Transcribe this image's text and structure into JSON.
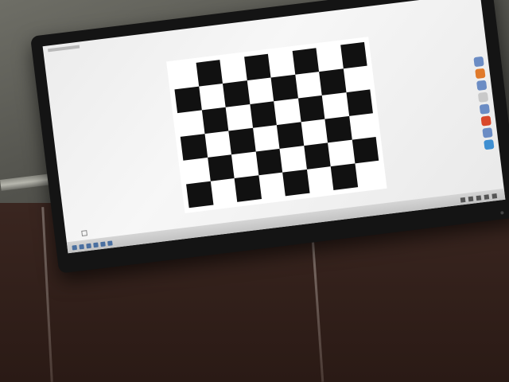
{
  "photo": {
    "subject": "",
    "monitor_content": "",
    "board": {
      "columns": 8,
      "rows": 6,
      "dark_color": "#111111",
      "light_color": "#ffffff",
      "first_cell_dark": false
    },
    "screen_color": "#f2f2f2",
    "bezel_color": "#141414",
    "wall_color": "#55554f",
    "lower_wall_color": "#2a1a15"
  },
  "desktop": {
    "dock_icon_count": 8,
    "taskbar_icon_count": 6,
    "tray_icon_count": 5
  }
}
